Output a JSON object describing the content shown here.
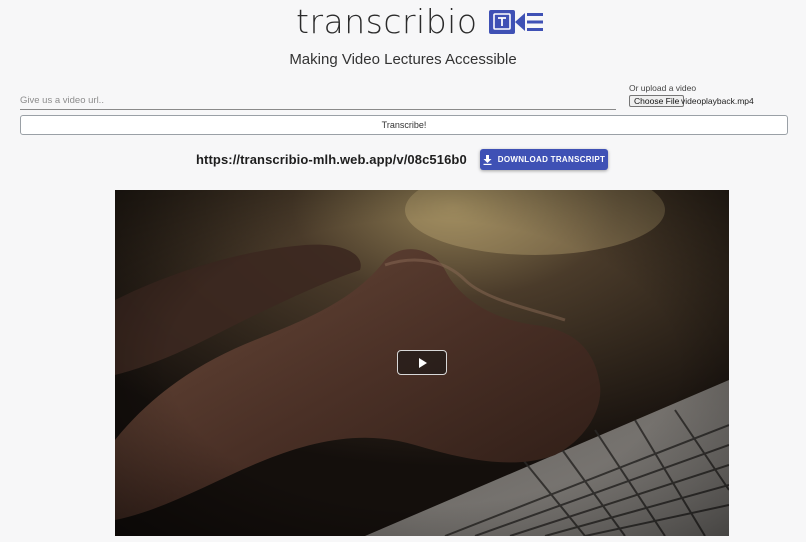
{
  "app": {
    "logo_text": "transcribio",
    "logo_icon": "video-camera-text-icon",
    "subtitle": "Making Video Lectures Accessible"
  },
  "form": {
    "url_placeholder": "Give us a video url..",
    "url_value": "",
    "upload_label": "Or upload a video",
    "choose_file_label": "Choose File",
    "file_name": "videoplayback.mp4",
    "transcribe_label": "Transcribe!"
  },
  "result": {
    "share_link": "https://transcribio-mlh.web.app/v/08c516b0",
    "download_label": "DOWNLOAD TRANSCRIPT",
    "download_icon": "download-icon"
  },
  "video": {
    "play_icon": "play-icon",
    "thumbnail": "hands typing on laptop keyboard"
  },
  "colors": {
    "brand": "#3f51b5",
    "background": "#f7f7f8"
  }
}
